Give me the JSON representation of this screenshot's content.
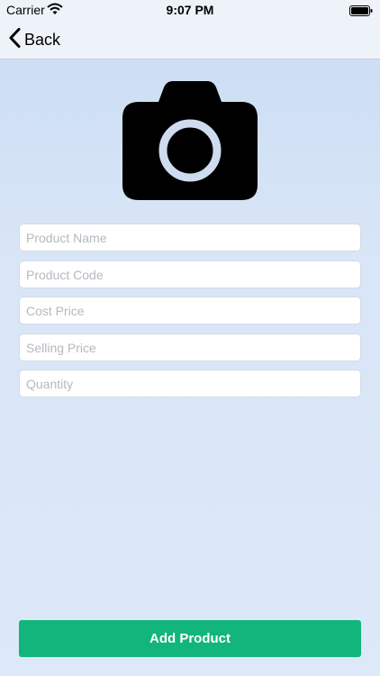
{
  "status_bar": {
    "carrier": "Carrier",
    "time": "9:07 PM",
    "wifi_icon": "wifi-icon",
    "battery_icon": "battery-icon"
  },
  "nav": {
    "back_label": "Back",
    "back_icon": "chevron-left-icon"
  },
  "photo": {
    "icon": "camera-icon"
  },
  "form": {
    "fields": [
      {
        "placeholder": "Product Name",
        "value": ""
      },
      {
        "placeholder": "Product Code",
        "value": ""
      },
      {
        "placeholder": "Cost Price",
        "value": ""
      },
      {
        "placeholder": "Selling Price",
        "value": ""
      },
      {
        "placeholder": "Quantity",
        "value": ""
      }
    ],
    "submit_label": "Add Product"
  },
  "colors": {
    "accent": "#12b57a",
    "background_top": "#cadcf3",
    "background_bottom": "#dde8f8"
  }
}
